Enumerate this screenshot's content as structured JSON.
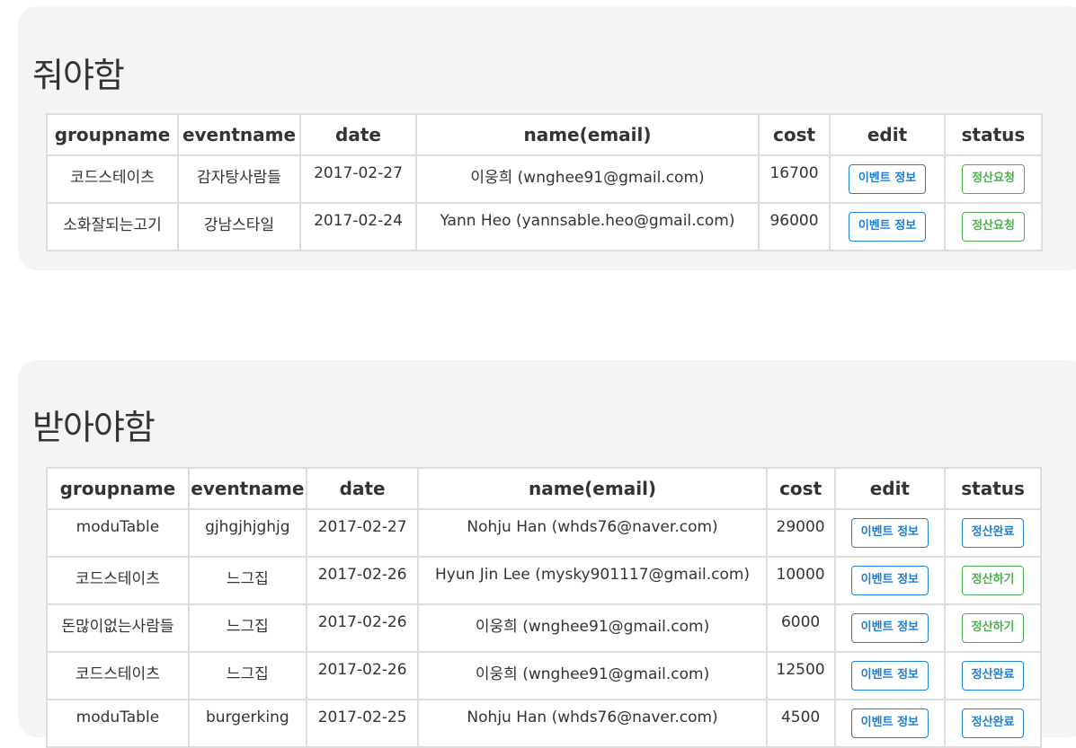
{
  "pay_section": {
    "title": "줘야함",
    "columns": [
      "groupname",
      "eventname",
      "date",
      "name(email)",
      "cost",
      "edit",
      "status"
    ],
    "rows": [
      {
        "groupname": "코드스테이츠",
        "eventname": "감자탕사람들",
        "date": "2017-02-27",
        "name_email": "이웅희 (wnghee91@gmail.com)",
        "cost": "16700",
        "edit": "이벤트 정보",
        "status": "정산요청",
        "status_color": "green"
      },
      {
        "groupname": "소화잘되는고기",
        "eventname": "강남스타일",
        "date": "2017-02-24",
        "name_email": "Yann Heo (yannsable.heo@gmail.com)",
        "cost": "96000",
        "edit": "이벤트 정보",
        "status": "정산요청",
        "status_color": "green"
      }
    ]
  },
  "receive_section": {
    "title": "받아야함",
    "columns": [
      "groupname",
      "eventname",
      "date",
      "name(email)",
      "cost",
      "edit",
      "status"
    ],
    "rows": [
      {
        "groupname": "moduTable",
        "eventname": "gjhgjhjghjg",
        "date": "2017-02-27",
        "name_email": "Nohju Han (whds76@naver.com)",
        "cost": "29000",
        "edit": "이벤트 정보",
        "status": "정산완료",
        "status_color": "blue"
      },
      {
        "groupname": "코드스테이츠",
        "eventname": "느그집",
        "date": "2017-02-26",
        "name_email": "Hyun Jin Lee (mysky901117@gmail.com)",
        "cost": "10000",
        "edit": "이벤트 정보",
        "status": "정산하기",
        "status_color": "green"
      },
      {
        "groupname": "돈많이없는사람들",
        "eventname": "느그집",
        "date": "2017-02-26",
        "name_email": "이웅희 (wnghee91@gmail.com)",
        "cost": "6000",
        "edit": "이벤트 정보",
        "status": "정산하기",
        "status_color": "green"
      },
      {
        "groupname": "코드스테이츠",
        "eventname": "느그집",
        "date": "2017-02-26",
        "name_email": "이웅희 (wnghee91@gmail.com)",
        "cost": "12500",
        "edit": "이벤트 정보",
        "status": "정산완료",
        "status_color": "blue"
      },
      {
        "groupname": "moduTable",
        "eventname": "burgerking",
        "date": "2017-02-25",
        "name_email": "Nohju Han (whds76@naver.com)",
        "cost": "4500",
        "edit": "이벤트 정보",
        "status": "정산완료",
        "status_color": "blue"
      }
    ]
  },
  "colors": {
    "panel_bg": "#f4f4f4",
    "border": "#dddddd",
    "blue": "#1b7fd6",
    "green": "#4caf50",
    "text": "#333333"
  }
}
